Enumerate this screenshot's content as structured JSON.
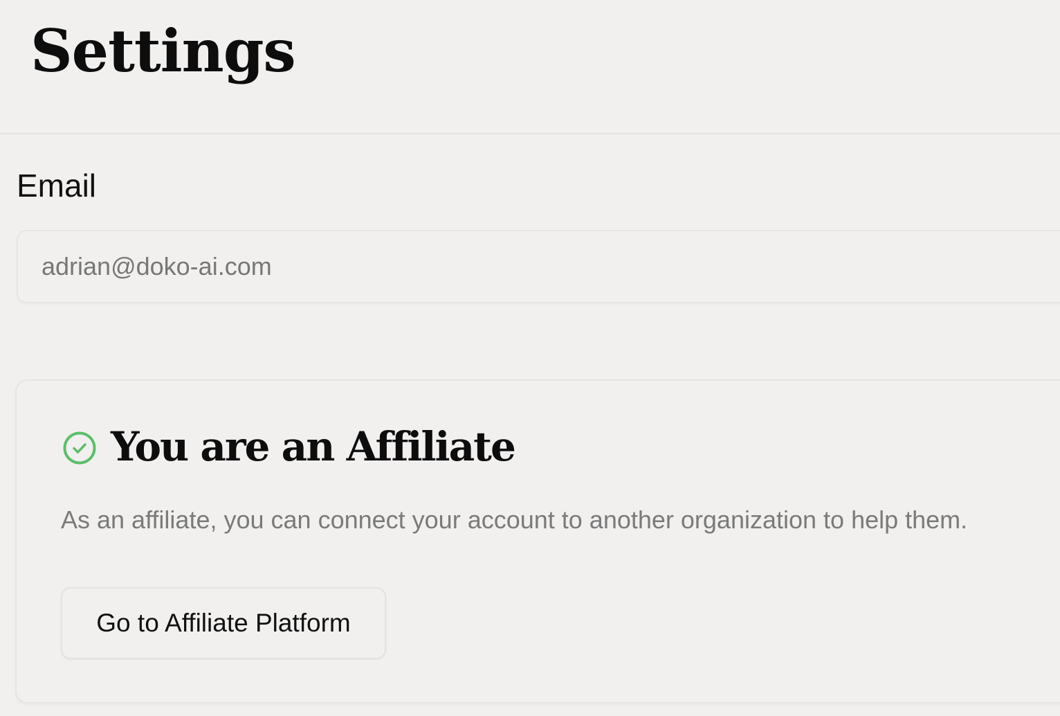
{
  "header": {
    "title": "Settings"
  },
  "email_section": {
    "label": "Email",
    "value": "adrian@doko-ai.com"
  },
  "affiliate_card": {
    "icon": "check-circle-icon",
    "title": "You are an Affiliate",
    "description": "As an affiliate, you can connect your account to another organization to help them.",
    "button_label": "Go to Affiliate Platform"
  },
  "colors": {
    "background": "#f1f0ef",
    "success_green": "#5cbf6a",
    "muted_text": "#7a7a7a",
    "border": "#e6e5e3"
  }
}
